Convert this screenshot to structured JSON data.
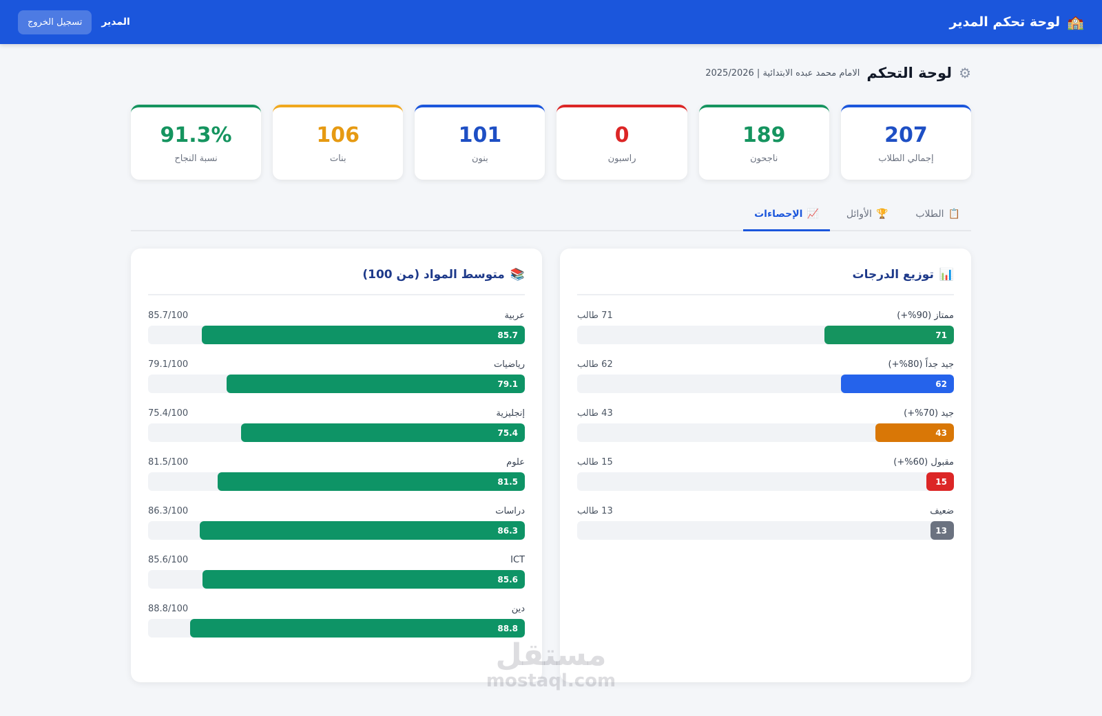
{
  "header": {
    "icon": "school-icon",
    "title": "لوحة تحكم المدير",
    "role": "المدير",
    "logout_label": "تسجيل الخروج",
    "bg_color": "#1b56dc"
  },
  "page": {
    "title": "لوحة التحكم",
    "subtitle": "الامام محمد عبده الابتدائية | 2025/2026"
  },
  "stats": [
    {
      "value": "207",
      "label": "إجمالي الطلاب",
      "color": "#1e4fc4",
      "top": "#1b56dc"
    },
    {
      "value": "189",
      "label": "ناجحون",
      "color": "#15945f",
      "top": "#15945f"
    },
    {
      "value": "0",
      "label": "راسبون",
      "color": "#dc2626",
      "top": "#dc2626"
    },
    {
      "value": "101",
      "label": "بنون",
      "color": "#1e4fc4",
      "top": "#1b56dc"
    },
    {
      "value": "106",
      "label": "بنات",
      "color": "#e69a12",
      "top": "#f0a81e"
    },
    {
      "value": "91.3%",
      "label": "نسبة النجاح",
      "color": "#15945f",
      "top": "#15945f"
    }
  ],
  "tabs": [
    {
      "label": "الطلاب",
      "icon": "clipboard-icon",
      "active": false
    },
    {
      "label": "الأوائل",
      "icon": "trophy-icon",
      "active": false
    },
    {
      "label": "الإحصاءات",
      "icon": "chart-up-icon",
      "active": true
    }
  ],
  "grades_panel": {
    "title": "توزيع الدرجات",
    "icon": "bar-chart-icon",
    "total": 207,
    "rows": [
      {
        "label": "ممتاز (90%+)",
        "count_text": "71 طالب",
        "value": 71,
        "color": "#15945f"
      },
      {
        "label": "جيد جداً (80%+)",
        "count_text": "62 طالب",
        "value": 62,
        "color": "#2563eb"
      },
      {
        "label": "جيد (70%+)",
        "count_text": "43 طالب",
        "value": 43,
        "color": "#d97706"
      },
      {
        "label": "مقبول (60%+)",
        "count_text": "15 طالب",
        "value": 15,
        "color": "#dc2626"
      },
      {
        "label": "ضعيف",
        "count_text": "13 طالب",
        "value": 13,
        "color": "#6b7280"
      }
    ]
  },
  "subjects_panel": {
    "title": "متوسط المواد (من 100)",
    "icon": "books-icon",
    "max": 100,
    "color": "#0e9466",
    "rows": [
      {
        "label": "عربية",
        "score_text": "85.7/100",
        "value": 85.7
      },
      {
        "label": "رياضيات",
        "score_text": "79.1/100",
        "value": 79.1
      },
      {
        "label": "إنجليزية",
        "score_text": "75.4/100",
        "value": 75.4
      },
      {
        "label": "علوم",
        "score_text": "81.5/100",
        "value": 81.5
      },
      {
        "label": "دراسات",
        "score_text": "86.3/100",
        "value": 86.3
      },
      {
        "label": "ICT",
        "score_text": "85.6/100",
        "value": 85.6
      },
      {
        "label": "دين",
        "score_text": "88.8/100",
        "value": 88.8
      }
    ]
  },
  "watermark": {
    "ar": "مستقل",
    "en": "mostaql.com"
  }
}
